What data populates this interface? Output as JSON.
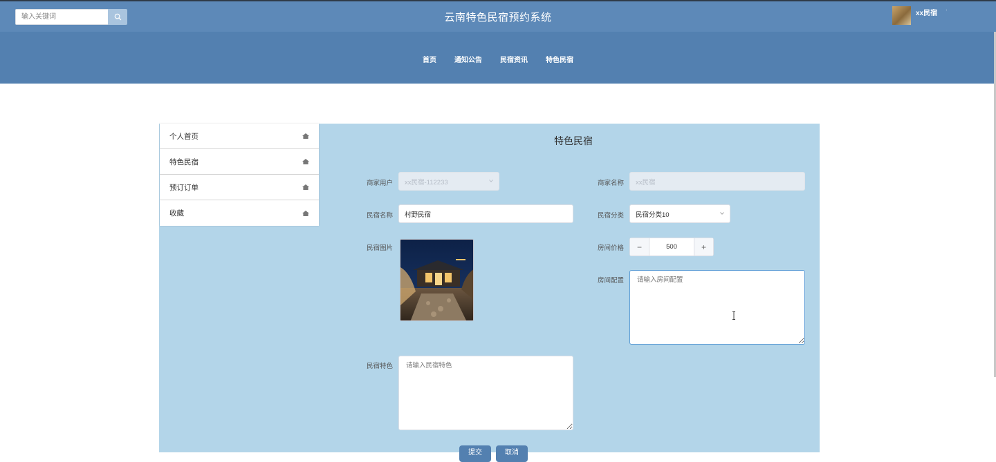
{
  "header": {
    "search_placeholder": "输入关键词",
    "site_title": "云南特色民宿预约系统",
    "username": "xx民宿",
    "user_caret": "·"
  },
  "nav": {
    "items": [
      {
        "label": "首页"
      },
      {
        "label": "通知公告"
      },
      {
        "label": "民宿资讯"
      },
      {
        "label": "特色民宿"
      }
    ]
  },
  "sidebar": {
    "items": [
      {
        "label": "个人首页"
      },
      {
        "label": "特色民宿"
      },
      {
        "label": "预订订单"
      },
      {
        "label": "收藏"
      }
    ]
  },
  "form": {
    "title": "特色民宿",
    "merchant_account": {
      "label": "商家用户",
      "value": "xx民宿-112233"
    },
    "merchant_name": {
      "label": "商家名称",
      "value": "xx民宿"
    },
    "homestay_name": {
      "label": "民宿名称",
      "value": "村野民宿"
    },
    "homestay_category": {
      "label": "民宿分类",
      "value": "民宿分类10"
    },
    "homestay_image": {
      "label": "民宿图片"
    },
    "room_price": {
      "label": "房间价格",
      "value": "500",
      "minus": "−",
      "plus": "+"
    },
    "room_config": {
      "label": "房间配置",
      "placeholder": "请输入房间配置"
    },
    "homestay_feature": {
      "label": "民宿特色",
      "placeholder": "请输入民宿特色"
    },
    "submit_label": "提交",
    "cancel_label": "取消"
  },
  "colors": {
    "topbar": "#5d89b8",
    "navbar": "#5380b0",
    "panel": "#b3d5e9",
    "button": "#5380b0"
  }
}
